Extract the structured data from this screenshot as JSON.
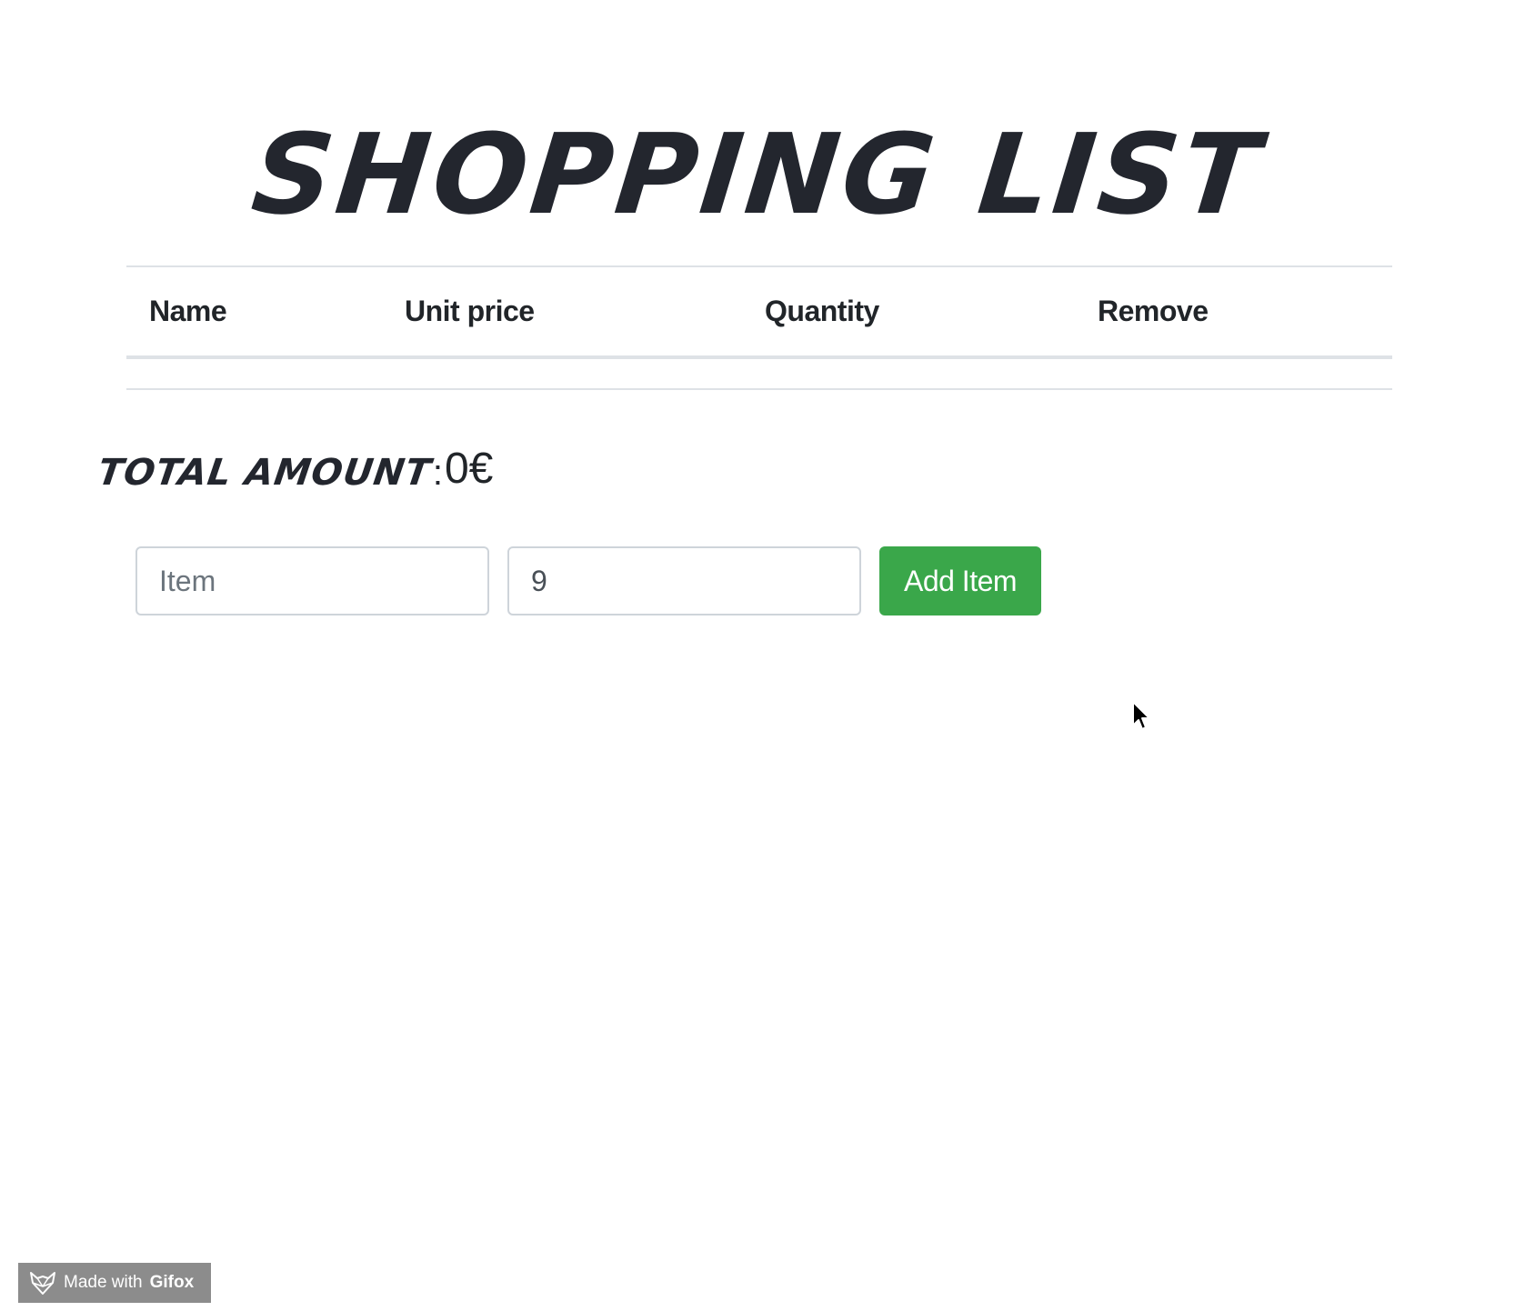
{
  "page": {
    "title": "SHOPPING LIST"
  },
  "table": {
    "columns": [
      "Name",
      "Unit price",
      "Quantity",
      "Remove"
    ],
    "rows": []
  },
  "total": {
    "label": "TOTAL AMOUNT",
    "separator": ":",
    "value": "0€"
  },
  "form": {
    "item_placeholder": "Item",
    "item_value": "",
    "quantity_value": "9",
    "add_button_label": "Add Item"
  },
  "badge": {
    "prefix": "Made with",
    "brand": "Gifox"
  },
  "colors": {
    "accent": "#3aa74a",
    "text": "#212529",
    "border": "#dee2e6",
    "badge_bg": "#8c8c8c"
  },
  "icons": {
    "badge_icon": "fox-head-icon",
    "pointer": "mouse-pointer-icon"
  }
}
